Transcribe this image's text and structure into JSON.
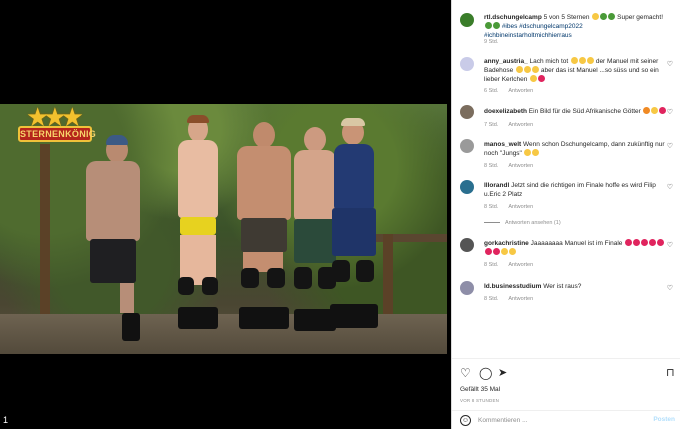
{
  "post": {
    "author": "rtl.dschungelcamp",
    "caption": "5 von 5 Sternen",
    "caption_tail": "Super gemacht!",
    "hashtags": "#ibes #dschungelcamp2022 #ichbineinstarholtmichhierraus",
    "time": "9 Std."
  },
  "video": {
    "logo_text": "STERNENKÖNIG",
    "corner_glyph": "1"
  },
  "comments": [
    {
      "user": "anny_austria_",
      "text_a": "Lach mich tot",
      "text_b": "der Manuel mit seiner Badehose",
      "text_c": "aber das ist Manuel ...so süss und so ein lieber Kerlchen",
      "time": "6 Std.",
      "reply": "Antworten"
    },
    {
      "user": "doexelizabeth",
      "text_a": "Ein Bild für die Süd Afrikanische Götter",
      "text_b": "",
      "text_c": "",
      "time": "7 Std.",
      "reply": "Antworten"
    },
    {
      "user": "manos_welt",
      "text_a": "Wenn schon Dschungelcamp, dann zukünftig nur noch \"Jungs\"",
      "text_b": "",
      "text_c": "",
      "time": "8 Std.",
      "reply": "Antworten"
    },
    {
      "user": "lllorandl",
      "text_a": "Jetzt sind die richtigen im Finale hoffe es wird Filip u.Eric 2 Platz",
      "text_b": "",
      "text_c": "",
      "time": "8 Std.",
      "reply": "Antworten",
      "view_replies": "Antworten ansehen (1)"
    },
    {
      "user": "gorkachristine",
      "text_a": "Jaaaaaaaa Manuel ist im Finale",
      "text_b": "",
      "text_c": "",
      "time": "8 Std.",
      "reply": "Antworten"
    },
    {
      "user": "ld.businesstudium",
      "text_a": "Wer ist raus?",
      "text_b": "",
      "text_c": "",
      "time": "8 Std.",
      "reply": "Antworten"
    }
  ],
  "actions": {
    "likes": "Gefällt 35 Mal",
    "posted": "VOR 8 STUNDEN"
  },
  "comment_box": {
    "placeholder": "Kommentieren ...",
    "post_label": "Posten"
  },
  "colors": {
    "link": "#00376b",
    "muted": "#8e8e8e",
    "post_disabled": "#b2dffc"
  }
}
